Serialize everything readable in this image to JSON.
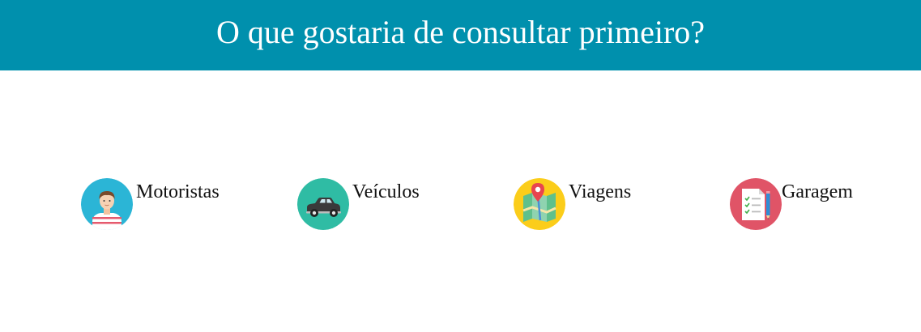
{
  "header": {
    "title": "O que gostaria de consultar primeiro?",
    "background_color": "#0090ad"
  },
  "options": [
    {
      "label": "Motoristas",
      "icon": "driver-avatar-icon",
      "icon_color": "#2bb5d6"
    },
    {
      "label": "Veículos",
      "icon": "car-icon",
      "icon_color": "#2fbca4"
    },
    {
      "label": "Viagens",
      "icon": "map-pin-icon",
      "icon_color": "#fbcd1a"
    },
    {
      "label": "Garagem",
      "icon": "checklist-icon",
      "icon_color": "#e05467"
    }
  ]
}
